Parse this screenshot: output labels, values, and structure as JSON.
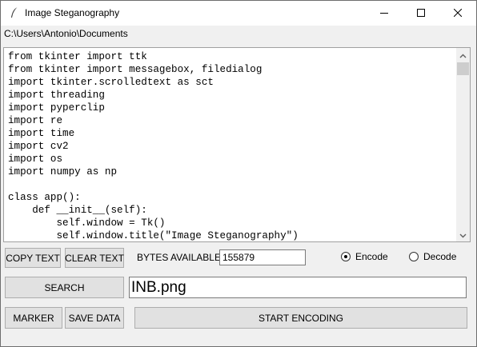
{
  "window": {
    "title": "Image Steganography",
    "minimize_glyph": "minimize-icon",
    "maximize_glyph": "maximize-icon",
    "close_glyph": "close-icon"
  },
  "path": "C:\\Users\\Antonio\\Documents",
  "code_lines": [
    "from tkinter import ttk",
    "from tkinter import messagebox, filedialog",
    "import tkinter.scrolledtext as sct",
    "import threading",
    "import pyperclip",
    "import re",
    "import time",
    "import cv2",
    "import os",
    "import numpy as np",
    "",
    "class app():",
    "    def __init__(self):",
    "        self.window = Tk()",
    "        self.window.title(\"Image Steganography\")"
  ],
  "toolbar": {
    "copy_label": "COPY TEXT",
    "clear_label": "CLEAR TEXT",
    "bytes_label": "BYTES AVAILABLE:",
    "bytes_value": "155879",
    "mode_options": [
      {
        "label": "Encode",
        "selected": true
      },
      {
        "label": "Decode",
        "selected": false
      }
    ]
  },
  "search": {
    "button_label": "SEARCH",
    "file_value": "INB.png"
  },
  "actions": {
    "marker_label": "MARKER",
    "save_label": "SAVE DATA",
    "start_label": "START ENCODING"
  }
}
